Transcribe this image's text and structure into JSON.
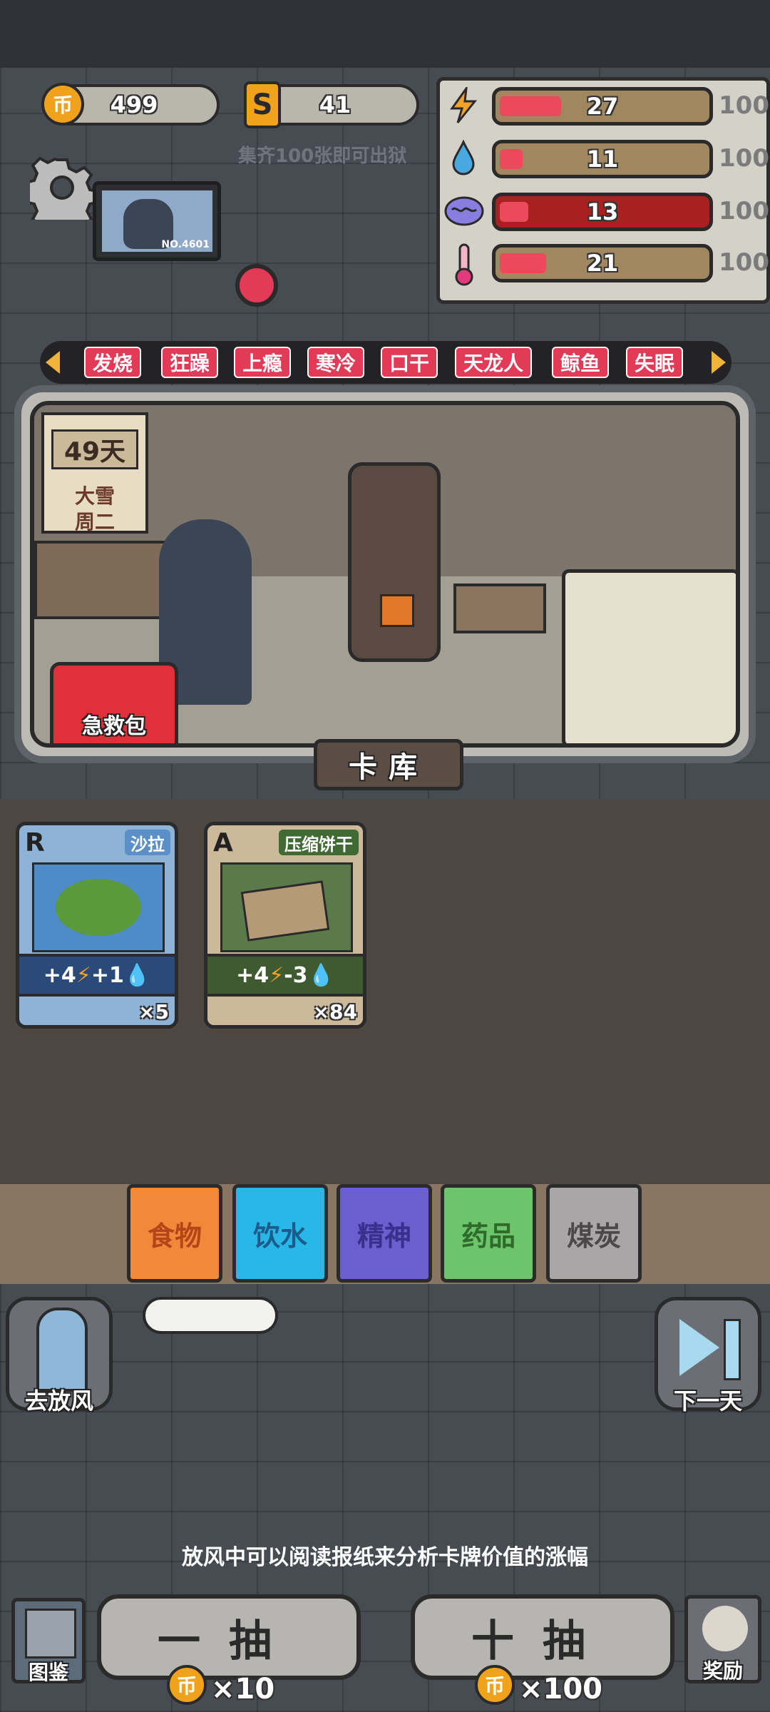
{
  "currency": {
    "coin_icon": "币",
    "coins": "499",
    "tickets": "41",
    "ticket_icon": "S",
    "hint": "集齐100张即可出狱"
  },
  "stats": [
    {
      "icon": "lightning-icon",
      "value": "27",
      "max": "100",
      "fill": 0.27
    },
    {
      "icon": "water-drop-icon",
      "value": "11",
      "max": "100",
      "fill": 0.11
    },
    {
      "icon": "brain-icon",
      "value": "13",
      "max": "100",
      "fill": 0.13
    },
    {
      "icon": "thermometer-icon",
      "value": "21",
      "max": "100",
      "fill": 0.21
    }
  ],
  "portrait_label": "NO.4601",
  "status_tags": [
    "发烧",
    "狂躁",
    "上瘾",
    "寒冷",
    "口干",
    "天龙人",
    "鲸鱼",
    "失眠"
  ],
  "calendar": {
    "days": "49天",
    "weather": "大雪",
    "weekday": "周二"
  },
  "first_aid": "急救包",
  "deck_title": "卡库",
  "cards": [
    {
      "rarity": "R",
      "name": "沙拉",
      "effect_a": "+4",
      "effect_b": "+1",
      "count": "×5"
    },
    {
      "rarity": "A",
      "name": "压缩饼干",
      "effect_a": "+4",
      "effect_b": "-3",
      "count": "×84"
    }
  ],
  "categories": [
    "食物",
    "饮水",
    "精神",
    "药品",
    "煤炭"
  ],
  "actions": {
    "go_out": "去放风",
    "next_day": "下一天",
    "codex": "图鉴",
    "reward": "奖励"
  },
  "tip": "放风中可以阅读报纸来分析卡牌价值的涨幅",
  "draw": {
    "single": "一抽",
    "single_cost": "×10",
    "ten": "十抽",
    "ten_cost": "×100"
  },
  "colors": {
    "accent_red": "#e23a57",
    "coin": "#f0a21c",
    "food": "#f08a3a",
    "water": "#29b7e8",
    "spirit": "#6a5fcf",
    "medicine": "#6cc56a",
    "coal": "#a8a6a6"
  }
}
